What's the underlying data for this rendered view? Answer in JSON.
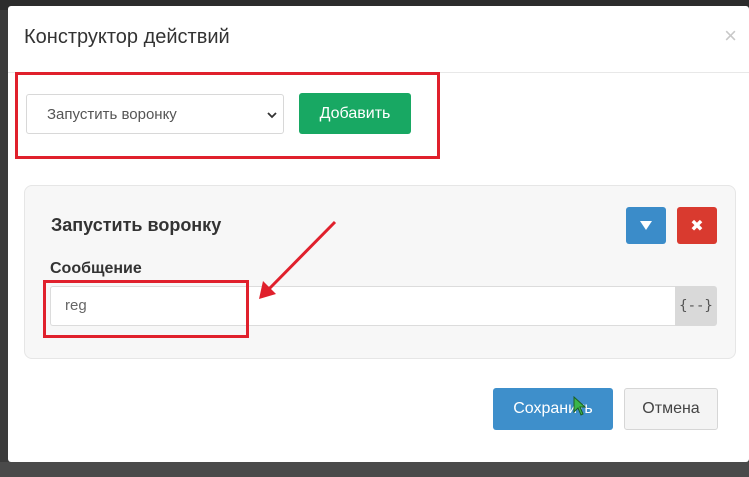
{
  "modal": {
    "title": "Конструктор действий",
    "close_glyph": "×"
  },
  "action_picker": {
    "selected": "Запустить воронку",
    "add_label": "Добавить"
  },
  "action_panel": {
    "title": "Запустить воронку",
    "move_down_glyph": "▼",
    "delete_glyph": "✖",
    "message_label": "Сообщение",
    "message_value": "reg",
    "variables_label": "{--}"
  },
  "footer": {
    "save_label": "Сохранить",
    "cancel_label": "Отмена"
  },
  "colors": {
    "add_button": "#18a863",
    "primary_button": "#3e8fcb",
    "danger_button": "#d93a2f",
    "annotation_red": "#e0202c"
  },
  "icons": {
    "chevron": "chevron-down-icon",
    "close": "close-icon",
    "move_down": "triangle-down-icon",
    "delete": "delete-icon",
    "annotation": "red-arrow-annotation",
    "cursor": "mouse-cursor-icon"
  }
}
